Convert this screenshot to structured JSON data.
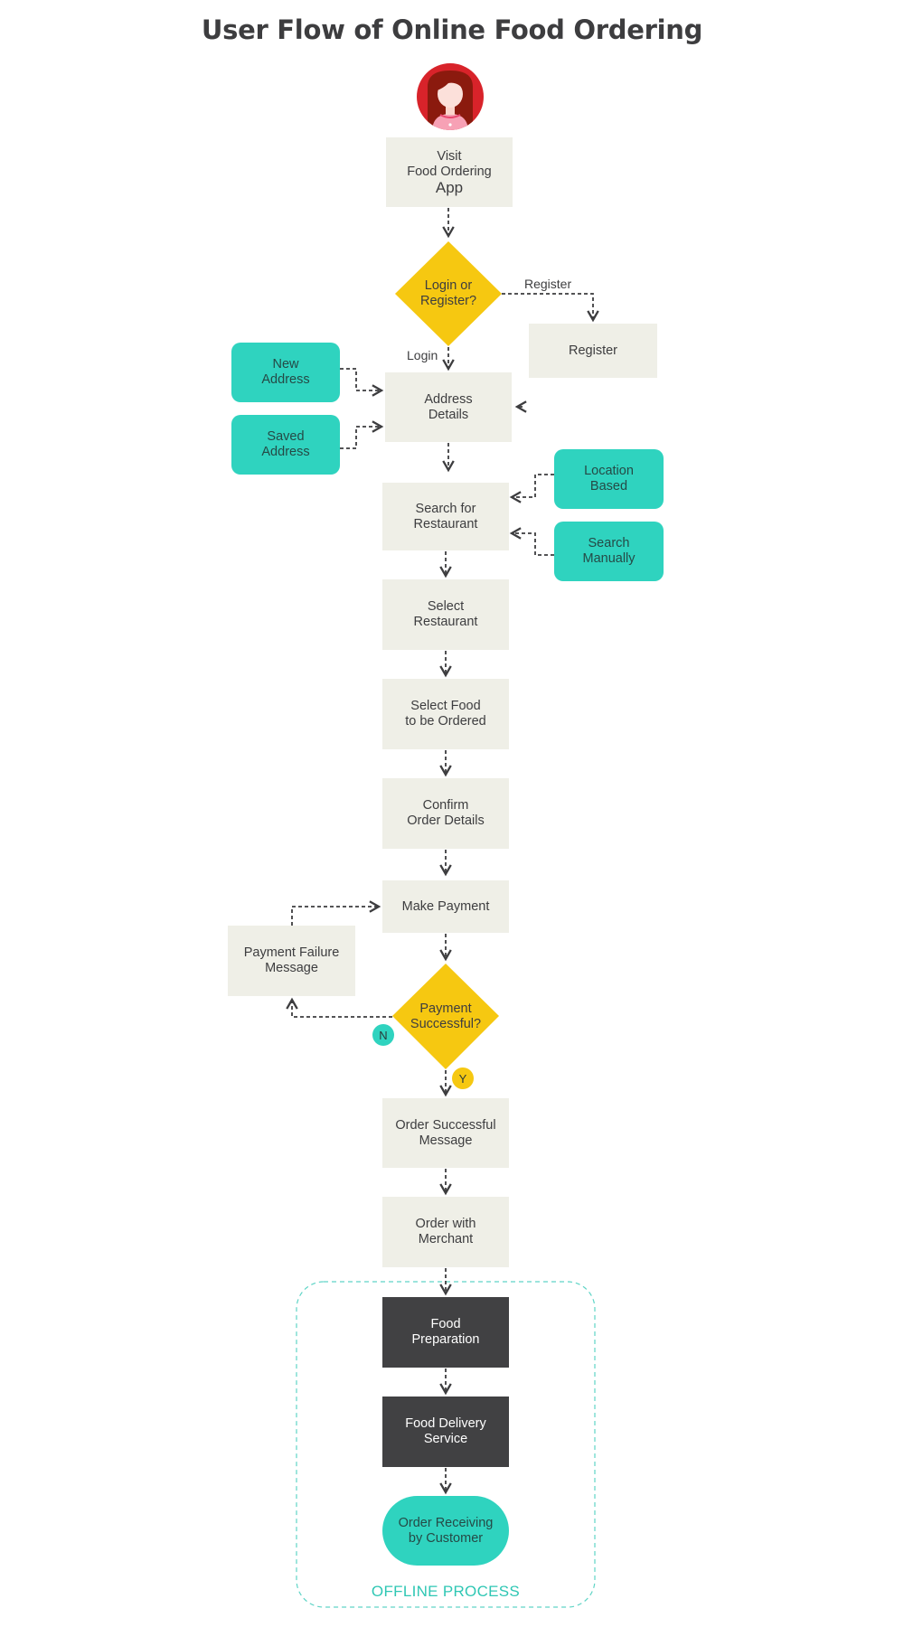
{
  "title": "User Flow of Online Food Ordering",
  "colors": {
    "process": "#efefe7",
    "option": "#2fd3bf",
    "decision": "#f6c811",
    "offline_step": "#414143",
    "offline_border": "#5fd4c6",
    "connector": "#3d3d3f",
    "avatar_bg": "#d8232a"
  },
  "actor": {
    "icon": "female-user-avatar-icon"
  },
  "nodes": {
    "visit": {
      "line1": "Visit\nFood Ordering",
      "line2": "App"
    },
    "login_decision": "Login or\nRegister?",
    "register": "Register",
    "address_details": "Address\nDetails",
    "new_address": "New\nAddress",
    "saved_address": "Saved\nAddress",
    "search_restaurant": "Search for\nRestaurant",
    "location_based": "Location\nBased",
    "search_manually": "Search\nManually",
    "select_restaurant": "Select\nRestaurant",
    "select_food": "Select Food\nto be Ordered",
    "confirm_order": "Confirm\nOrder Details",
    "make_payment": "Make Payment",
    "payment_failure": "Payment Failure\nMessage",
    "payment_decision": "Payment\nSuccessful?",
    "order_successful": "Order Successful\nMessage",
    "order_merchant": "Order with\nMerchant",
    "food_preparation": "Food\nPreparation",
    "food_delivery": "Food Delivery\nService",
    "order_receiving": "Order Receiving\nby Customer"
  },
  "edge_labels": {
    "register": "Register",
    "login": "Login",
    "no": "N",
    "yes": "Y"
  },
  "offline_group": {
    "label": "OFFLINE PROCESS"
  }
}
